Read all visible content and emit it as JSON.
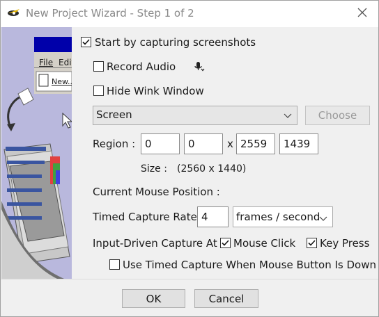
{
  "window": {
    "title": "New Project Wizard - Step 1 of 2",
    "icon": "wink-app-icon",
    "close_icon": "close-icon"
  },
  "sidebar_graphic": {
    "menu_file": "File",
    "menu_edit": "Edit",
    "menu_new": "New..."
  },
  "options": {
    "start_capture_label": "Start by capturing screenshots",
    "start_capture_checked": true,
    "record_audio_label": "Record Audio",
    "record_audio_checked": false,
    "hide_wink_label": "Hide Wink Window",
    "hide_wink_checked": false
  },
  "capture_source": {
    "selected": "Screen",
    "choose_label": "Choose"
  },
  "region": {
    "label": "Region :",
    "x": "0",
    "y": "0",
    "separator": "x",
    "width": "2559",
    "height": "1439"
  },
  "size": {
    "label": "Size :",
    "value": "(2560 x 1440)"
  },
  "mouse": {
    "label": "Current Mouse Position :"
  },
  "timed": {
    "label": "Timed Capture Rate",
    "value": "4",
    "unit": "frames / second"
  },
  "input_driven": {
    "label": "Input-Driven Capture At",
    "mouse_click_label": "Mouse Click",
    "mouse_click_checked": true,
    "key_press_label": "Key Press",
    "key_press_checked": true
  },
  "timed_when_down": {
    "label": "Use Timed Capture When Mouse Button Is Down",
    "checked": false
  },
  "footer": {
    "ok_label": "OK",
    "cancel_label": "Cancel"
  }
}
